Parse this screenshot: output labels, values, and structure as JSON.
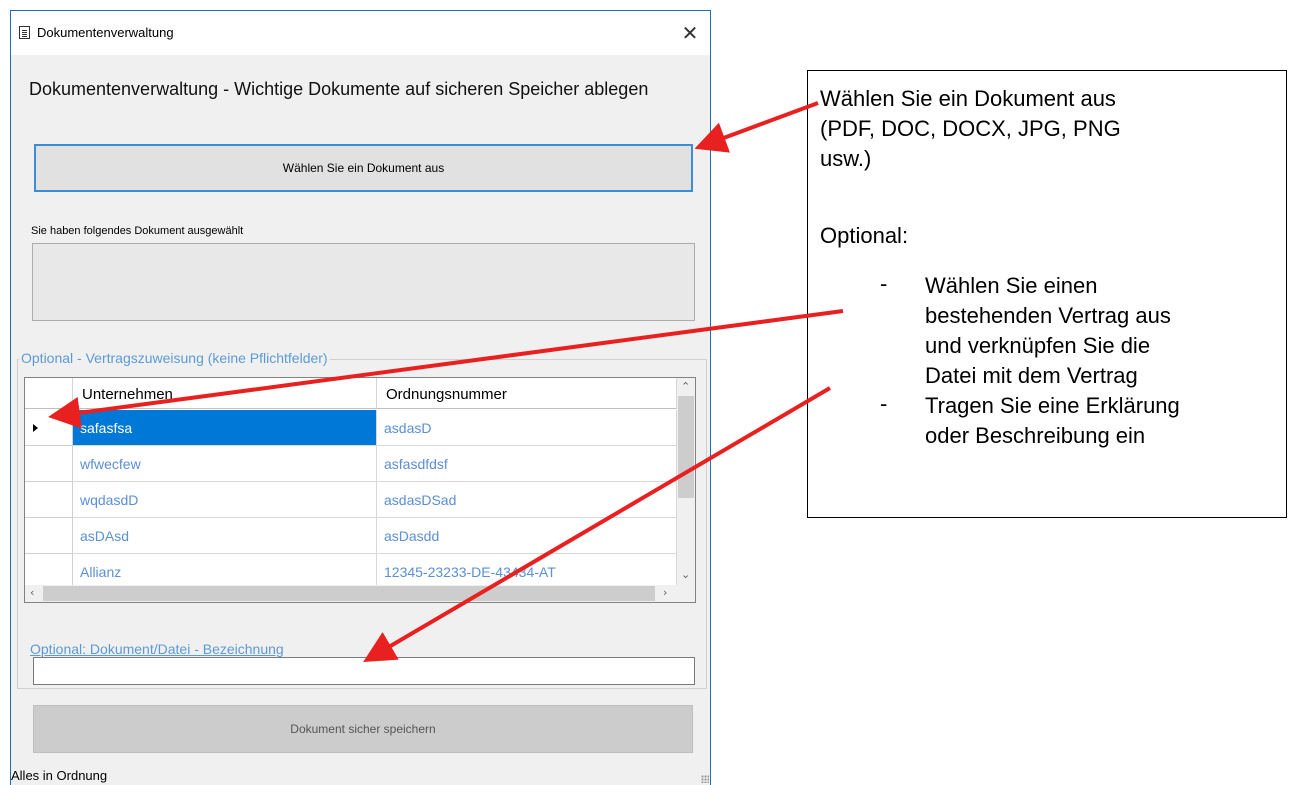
{
  "window": {
    "title": "Dokumentenverwaltung",
    "close_glyph": "✕"
  },
  "main": {
    "heading": "Dokumentenverwaltung - Wichtige Dokumente auf sicheren Speicher ablegen",
    "choose_button_label": "Wählen Sie ein Dokument aus",
    "selected_label": "Sie haben folgendes Dokument ausgewählt",
    "selected_value": ""
  },
  "contract_group": {
    "legend": "Optional - Vertragszuweisung (keine Pflichtfelder)",
    "columns": [
      "Unternehmen",
      "Ordnungsnummer"
    ],
    "rows": [
      {
        "company": "safasfsa",
        "number": "asdasD"
      },
      {
        "company": "wfwecfew",
        "number": "asfasdfdsf"
      },
      {
        "company": "wqdasdD",
        "number": "asdasDSad"
      },
      {
        "company": "asDAsd",
        "number": "asDasdd"
      },
      {
        "company": "Allianz",
        "number": "12345-23233-DE-43434-AT"
      }
    ],
    "selected_row": 0,
    "name_label": "Optional: Dokument/Datei - Bezeichnung",
    "name_value": ""
  },
  "save_button_label": "Dokument sicher speichern",
  "status": {
    "text": "Alles in Ordnung"
  },
  "callout": {
    "line1": "Wählen Sie ein Dokument aus",
    "line2": "(PDF, DOC, DOCX, JPG, PNG",
    "line3": "usw.)",
    "optional": "Optional:",
    "bullet1": [
      "Wählen Sie einen",
      "bestehenden Vertrag aus",
      "und verknüpfen Sie die",
      "Datei mit dem Vertrag"
    ],
    "bullet2": [
      "Tragen Sie eine Erklärung",
      "oder Beschreibung ein"
    ],
    "dash": "-"
  },
  "colors": {
    "accent": "#0078d7",
    "link_blue": "#5b9bd5",
    "arrow_red": "#e8201f"
  },
  "icons": {
    "title": "document-icon",
    "close": "close-icon",
    "row_indicator": "triangle-right-icon"
  }
}
